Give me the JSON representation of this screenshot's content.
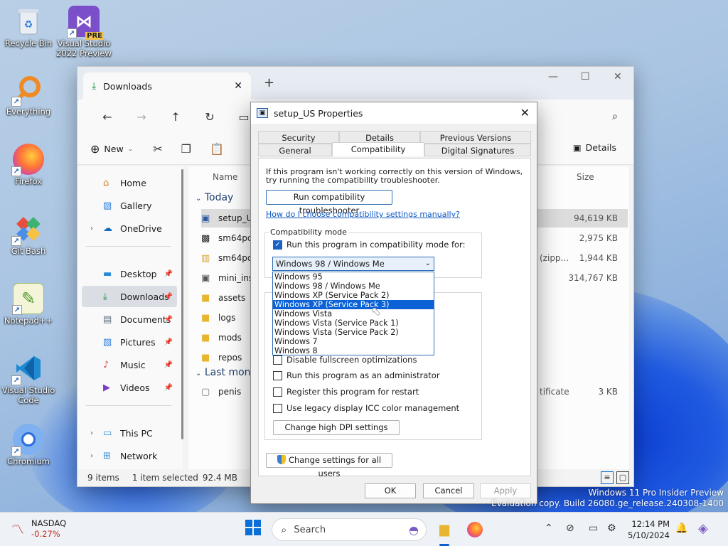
{
  "desktop_icons": [
    {
      "label": "Recycle Bin",
      "icon": "recycle-bin-icon"
    },
    {
      "label": "Visual Studio 2022 Preview",
      "icon": "visual-studio-preview-icon",
      "badge": "PRE"
    },
    {
      "label": "Everything",
      "icon": "everything-search-icon"
    },
    {
      "label": "Firefox",
      "icon": "firefox-icon"
    },
    {
      "label": "Git Bash",
      "icon": "git-bash-icon"
    },
    {
      "label": "Notepad++",
      "icon": "notepad-plus-plus-icon"
    },
    {
      "label": "Visual Studio Code",
      "icon": "vscode-icon"
    },
    {
      "label": "Chromium",
      "icon": "chromium-icon"
    }
  ],
  "explorer": {
    "tab_title": "Downloads",
    "new_label": "New",
    "details_label": "Details",
    "sidebar": {
      "home": "Home",
      "gallery": "Gallery",
      "onedrive": "OneDrive",
      "desktop": "Desktop",
      "downloads": "Downloads",
      "documents": "Documents",
      "pictures": "Pictures",
      "music": "Music",
      "videos": "Videos",
      "thispc": "This PC",
      "network": "Network"
    },
    "columns": {
      "name": "Name",
      "size": "Size"
    },
    "groups": {
      "today": "Today",
      "last_month": "Last mont"
    },
    "files": [
      {
        "name": "setup_US",
        "size": "94,619 KB",
        "type": ""
      },
      {
        "name": "sm64pcB",
        "size": "2,975 KB",
        "type": ""
      },
      {
        "name": "sm64pcb",
        "size": "1,944 KB",
        "type": "(zipp..."
      },
      {
        "name": "mini_inst",
        "size": "314,767 KB",
        "type": ""
      },
      {
        "name": "assets",
        "size": "",
        "type": ""
      },
      {
        "name": "logs",
        "size": "",
        "type": ""
      },
      {
        "name": "mods",
        "size": "",
        "type": ""
      },
      {
        "name": "repos",
        "size": "",
        "type": ""
      },
      {
        "name": "penis",
        "size": "3 KB",
        "type": "tificate"
      }
    ],
    "status": {
      "items": "9 items",
      "selected": "1 item selected",
      "size": "92.4 MB"
    }
  },
  "dialog": {
    "title": "setup_US Properties",
    "tabs": {
      "security": "Security",
      "details": "Details",
      "previous_versions": "Previous Versions",
      "general": "General",
      "compatibility": "Compatibility",
      "digital_signatures": "Digital Signatures"
    },
    "intro_line1": "If this program isn't working correctly on this version of Windows,",
    "intro_line2": "try running the compatibility troubleshooter.",
    "troubleshooter_button": "Run compatibility troubleshooter",
    "help_link": "How do I choose compatibility settings manually?",
    "compat_group_label": "Compatibility mode",
    "compat_checkbox": "Run this program in compatibility mode for:",
    "compat_selected": "Windows 98 / Windows Me",
    "compat_options": [
      "Windows 95",
      "Windows 98 / Windows Me",
      "Windows XP (Service Pack 2)",
      "Windows XP (Service Pack 3)",
      "Windows Vista",
      "Windows Vista (Service Pack 1)",
      "Windows Vista (Service Pack 2)",
      "Windows 7",
      "Windows 8"
    ],
    "highlighted_option": "Windows XP (Service Pack 3)",
    "settings": {
      "fullscreen": "Disable fullscreen optimizations",
      "admin": "Run this program as an administrator",
      "restart": "Register this program for restart",
      "icc": "Use legacy display ICC color management"
    },
    "dpi_button": "Change high DPI settings",
    "all_users_button": "Change settings for all users",
    "ok": "OK",
    "cancel": "Cancel",
    "apply": "Apply"
  },
  "watermark": {
    "line1": "Windows 11 Pro Insider Preview",
    "line2": "Evaluation copy. Build 26080.ge_release.240308-1400"
  },
  "taskbar": {
    "stock_name": "NASDAQ",
    "stock_change": "-0.27%",
    "search_placeholder": "Search",
    "time": "12:14 PM",
    "date": "5/10/2024"
  }
}
